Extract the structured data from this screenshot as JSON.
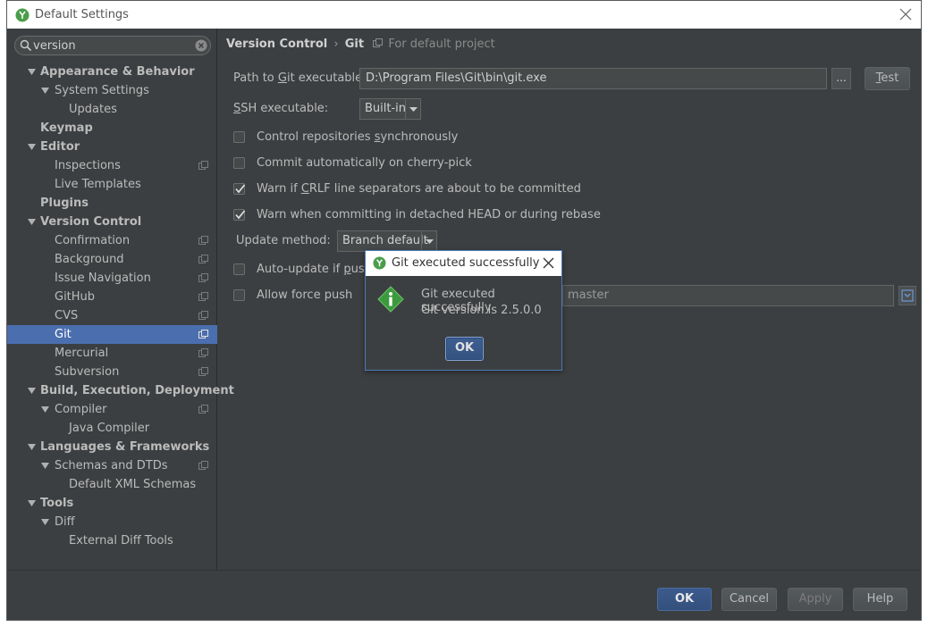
{
  "window": {
    "title": "Default Settings"
  },
  "search": {
    "value": "version"
  },
  "tree": [
    {
      "label": "Appearance & Behavior",
      "level": 0,
      "bold": true,
      "arrow": true
    },
    {
      "label": "System Settings",
      "level": 1,
      "arrow": true
    },
    {
      "label": "Updates",
      "level": 2
    },
    {
      "label": "Keymap",
      "level": 0,
      "bold": true
    },
    {
      "label": "Editor",
      "level": 0,
      "bold": true,
      "arrow": true
    },
    {
      "label": "Inspections",
      "level": 1,
      "proj": true
    },
    {
      "label": "Live Templates",
      "level": 1
    },
    {
      "label": "Plugins",
      "level": 0,
      "bold": true
    },
    {
      "label": "Version Control",
      "level": 0,
      "bold": true,
      "arrow": true
    },
    {
      "label": "Confirmation",
      "level": 1,
      "proj": true
    },
    {
      "label": "Background",
      "level": 1,
      "proj": true
    },
    {
      "label": "Issue Navigation",
      "level": 1,
      "proj": true
    },
    {
      "label": "GitHub",
      "level": 1,
      "proj": true
    },
    {
      "label": "CVS",
      "level": 1,
      "proj": true
    },
    {
      "label": "Git",
      "level": 1,
      "proj": true,
      "selected": true
    },
    {
      "label": "Mercurial",
      "level": 1,
      "proj": true
    },
    {
      "label": "Subversion",
      "level": 1,
      "proj": true
    },
    {
      "label": "Build, Execution, Deployment",
      "level": 0,
      "bold": true,
      "arrow": true
    },
    {
      "label": "Compiler",
      "level": 1,
      "arrow": true,
      "proj": true
    },
    {
      "label": "Java Compiler",
      "level": 2
    },
    {
      "label": "Languages & Frameworks",
      "level": 0,
      "bold": true,
      "arrow": true
    },
    {
      "label": "Schemas and DTDs",
      "level": 1,
      "arrow": true,
      "proj": true
    },
    {
      "label": "Default XML Schemas",
      "level": 2
    },
    {
      "label": "Tools",
      "level": 0,
      "bold": true,
      "arrow": true
    },
    {
      "label": "Diff",
      "level": 1,
      "arrow": true
    },
    {
      "label": "External Diff Tools",
      "level": 2
    }
  ],
  "breadcrumb": {
    "parent": "Version Control",
    "separator": "›",
    "current": "Git",
    "scope": "For default project"
  },
  "git": {
    "path_label_pre": "Path to ",
    "path_label_u": "G",
    "path_label_post": "it executable:",
    "path_value": "D:\\Program Files\\Git\\bin\\git.exe",
    "browse_label": "...",
    "test_label_u": "T",
    "test_label_post": "est",
    "ssh_label_u": "S",
    "ssh_label_post": "SH executable:",
    "ssh_value": "Built-in",
    "update_method_label": "Update method:",
    "update_method_value": "Branch default",
    "protected_branches_value": "master"
  },
  "checkboxes": [
    {
      "pre": "Control repositories ",
      "u": "s",
      "post": "ynchronously",
      "checked": false
    },
    {
      "pre": "Commit automatically on cherry-pick",
      "u": "",
      "post": "",
      "checked": false
    },
    {
      "pre": "Warn if ",
      "u": "C",
      "post": "RLF line separators are about to be committed",
      "checked": true
    },
    {
      "pre": "Warn when committing in detached HEAD or during rebase",
      "u": "",
      "post": "",
      "checked": true
    },
    {
      "pre": "Auto-update if ",
      "u": "p",
      "post": "ush o",
      "checked": false
    },
    {
      "pre": "Allow force push",
      "u": "",
      "post": "",
      "checked": false
    }
  ],
  "footer": {
    "ok": "OK",
    "cancel": "Cancel",
    "apply": "Apply",
    "help": "Help"
  },
  "popup": {
    "title": "Git executed successfully",
    "line1": "Git executed successfully",
    "line2": "Git version is 2.5.0.0",
    "ok": "OK"
  },
  "colors": {
    "selection": "#4b6eaf",
    "panel": "#3c3f41",
    "accent": "#4a7ab8"
  },
  "icons": {
    "app": "intellij-app-icon",
    "info": "info-diamond-icon"
  }
}
